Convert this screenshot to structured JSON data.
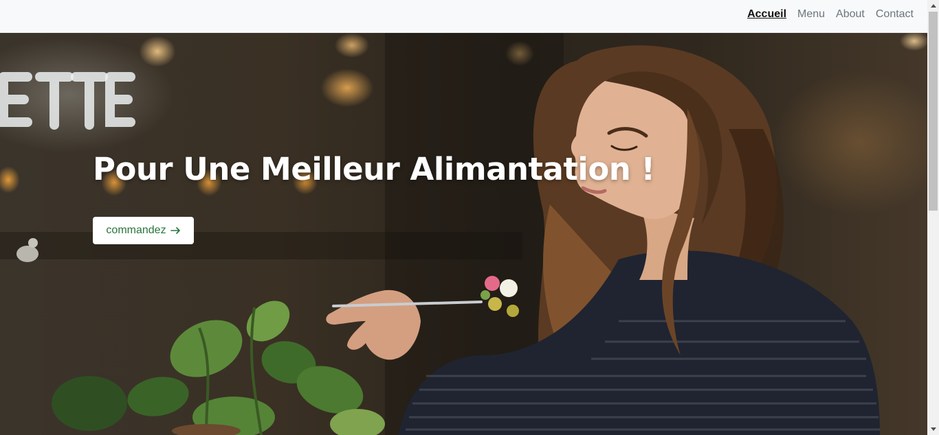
{
  "nav": {
    "items": [
      {
        "label": "Accueil",
        "active": true
      },
      {
        "label": "Menu",
        "active": false
      },
      {
        "label": "About",
        "active": false
      },
      {
        "label": "Contact",
        "active": false
      }
    ]
  },
  "hero": {
    "title": "Pour Une Meilleur Alimantation !",
    "button_label": "commandez",
    "button_icon": "arrow-right-icon",
    "image_description_icon": "woman-eating-photo"
  },
  "colors": {
    "navbar_bg": "#f8f9fa",
    "nav_active": "#111111",
    "nav_inactive": "#6c757d",
    "button_text": "#28743a",
    "button_bg": "#ffffff",
    "title": "#ffffff"
  }
}
